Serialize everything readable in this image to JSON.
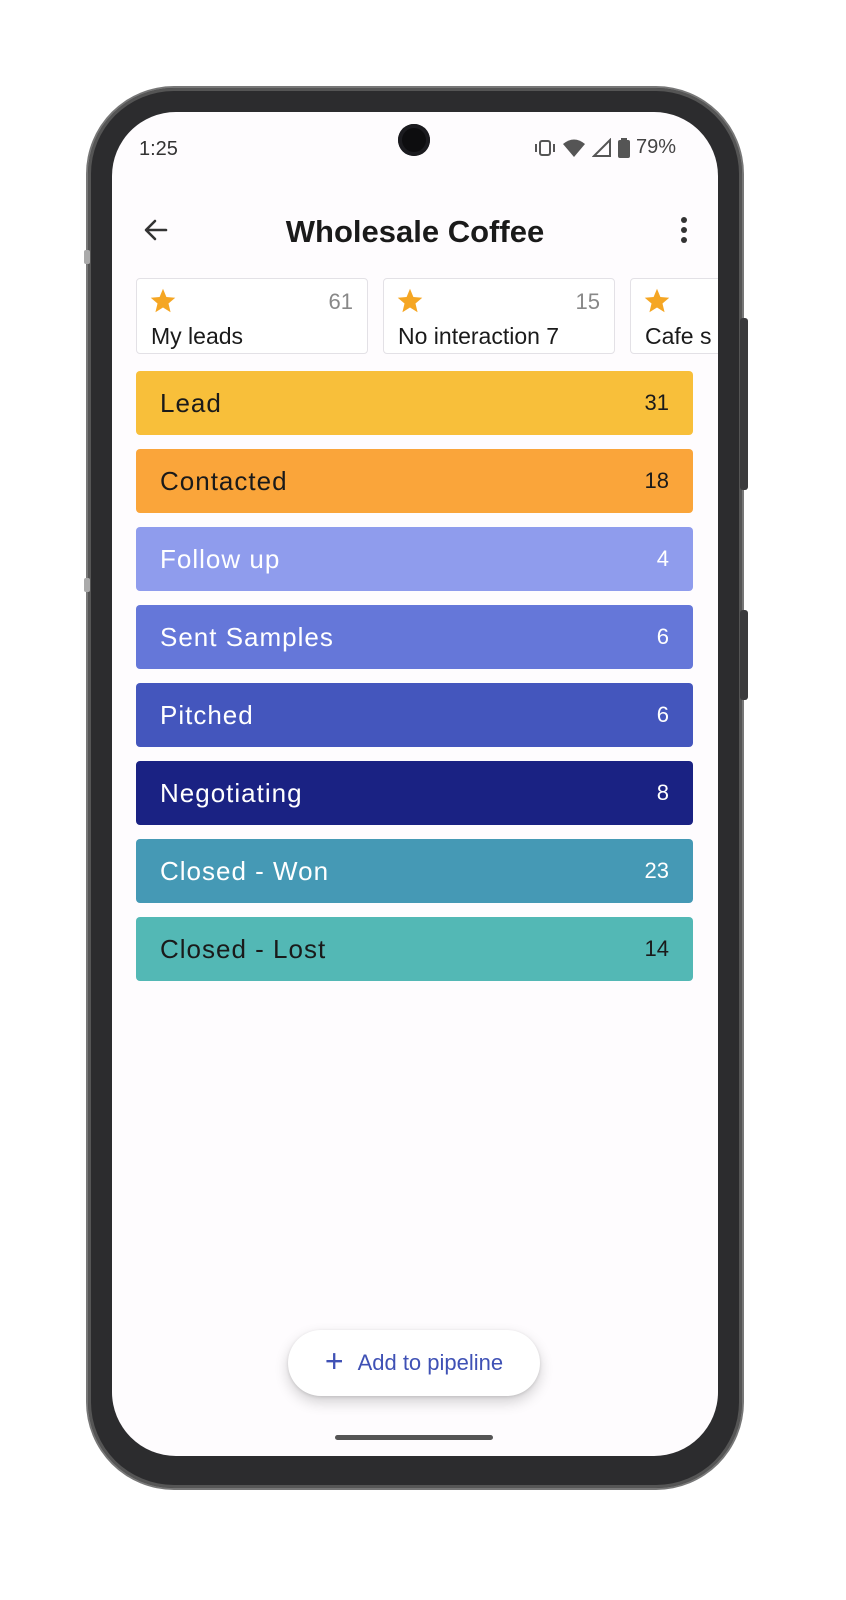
{
  "status_bar": {
    "time": "1:25",
    "battery": "79%"
  },
  "app_bar": {
    "title": "Wholesale Coffee"
  },
  "filters": [
    {
      "label": "My leads",
      "count": "61"
    },
    {
      "label": "No interaction 7",
      "count": "15"
    },
    {
      "label": "Cafe s",
      "count": ""
    }
  ],
  "stages": [
    {
      "name": "Lead",
      "count": "31"
    },
    {
      "name": "Contacted",
      "count": "18"
    },
    {
      "name": "Follow up",
      "count": "4"
    },
    {
      "name": "Sent Samples",
      "count": "6"
    },
    {
      "name": "Pitched",
      "count": "6"
    },
    {
      "name": "Negotiating",
      "count": "8"
    },
    {
      "name": "Closed - Won",
      "count": "23"
    },
    {
      "name": "Closed - Lost",
      "count": "14"
    }
  ],
  "fab": {
    "label": "Add to pipeline"
  },
  "colors": {
    "star": "#f5a623",
    "accent": "#3f51b5",
    "stages": [
      "#f8bf3a",
      "#faa53a",
      "#8f9ced",
      "#6577d9",
      "#4456bd",
      "#1a2283",
      "#4599b5",
      "#53b8b5"
    ],
    "stage_text": [
      "#1a1a1a",
      "#1a1a1a",
      "#ffffff",
      "#ffffff",
      "#ffffff",
      "#ffffff",
      "#ffffff",
      "#1a1a1a"
    ]
  },
  "icons": {
    "back": "arrow-left-icon",
    "more": "more-vert-icon",
    "star": "star-icon",
    "add": "plus-icon"
  }
}
